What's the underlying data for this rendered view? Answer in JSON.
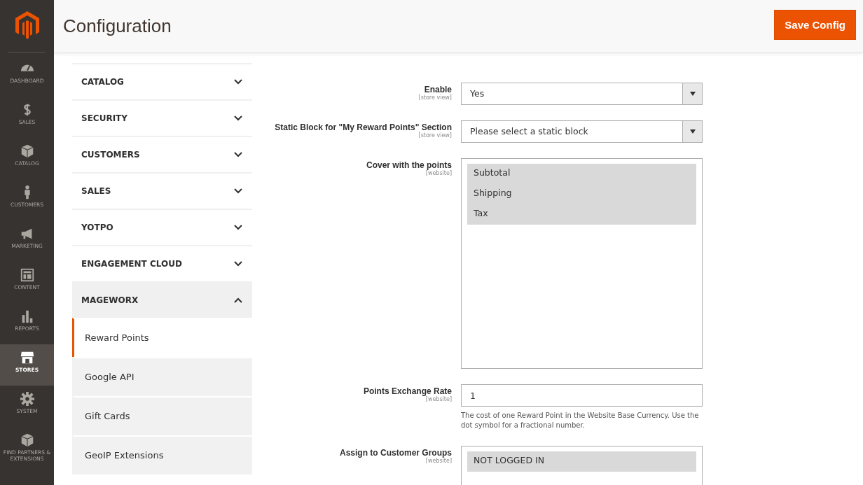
{
  "nav": [
    {
      "label": "DASHBOARD",
      "selected": false
    },
    {
      "label": "SALES",
      "selected": false
    },
    {
      "label": "CATALOG",
      "selected": false
    },
    {
      "label": "CUSTOMERS",
      "selected": false
    },
    {
      "label": "MARKETING",
      "selected": false
    },
    {
      "label": "CONTENT",
      "selected": false
    },
    {
      "label": "REPORTS",
      "selected": false
    },
    {
      "label": "STORES",
      "selected": true
    },
    {
      "label": "SYSTEM",
      "selected": false
    },
    {
      "label": "FIND PARTNERS & EXTENSIONS",
      "selected": false
    }
  ],
  "header": {
    "title": "Configuration",
    "save_button": "Save Config"
  },
  "sections": [
    {
      "label": "CATALOG",
      "expanded": false
    },
    {
      "label": "SECURITY",
      "expanded": false
    },
    {
      "label": "CUSTOMERS",
      "expanded": false
    },
    {
      "label": "SALES",
      "expanded": false
    },
    {
      "label": "YOTPO",
      "expanded": false
    },
    {
      "label": "ENGAGEMENT CLOUD",
      "expanded": false
    },
    {
      "label": "MAGEWORX",
      "expanded": true,
      "children": [
        {
          "label": "Reward Points",
          "selected": true
        },
        {
          "label": "Google API",
          "selected": false
        },
        {
          "label": "Gift Cards",
          "selected": false
        },
        {
          "label": "GeoIP Extensions",
          "selected": false
        }
      ]
    }
  ],
  "fields": [
    {
      "kind": "select",
      "label": "Enable",
      "scope": "[store view]",
      "value": "Yes"
    },
    {
      "kind": "select",
      "label": "Static Block for \"My Reward Points\" Section",
      "scope": "[store view]",
      "value": "Please select a static block"
    },
    {
      "kind": "multiselect",
      "label": "Cover with the points",
      "scope": "[website]",
      "options": [
        {
          "label": "Subtotal",
          "selected": true
        },
        {
          "label": "Shipping",
          "selected": true
        },
        {
          "label": "Tax",
          "selected": true
        }
      ]
    },
    {
      "kind": "text",
      "label": "Points Exchange Rate",
      "scope": "[website]",
      "value": "1",
      "note": "The cost of one Reward Point in the Website Base Currency. Use the dot symbol for a fractional number."
    },
    {
      "kind": "multiselect",
      "label": "Assign to Customer Groups",
      "scope": "[website]",
      "options": [
        {
          "label": "NOT LOGGED IN",
          "selected": true
        }
      ]
    }
  ]
}
